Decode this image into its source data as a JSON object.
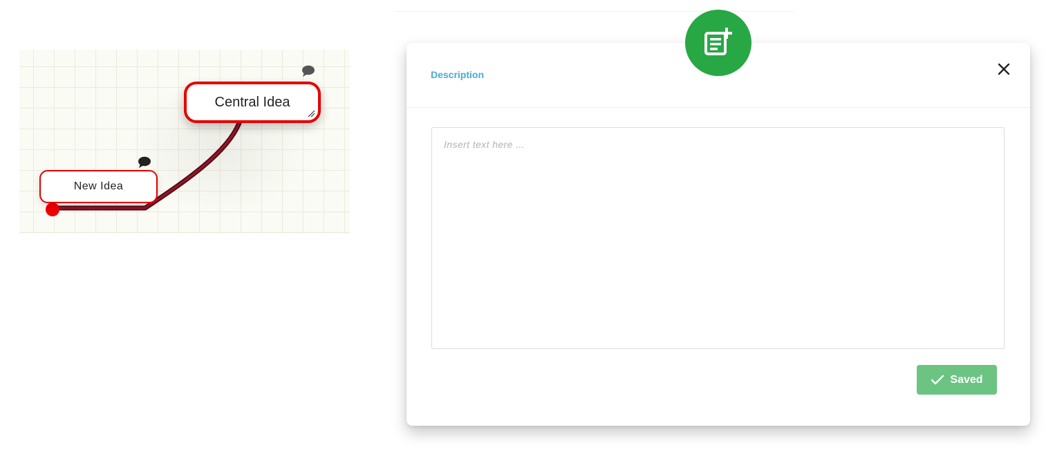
{
  "mindmap": {
    "central_node": {
      "label": "Central Idea",
      "border_color": "#e60000"
    },
    "child_node": {
      "label": "New Idea",
      "border_color": "#e60000"
    },
    "connector_color": "#7a0f22",
    "connector_dot_color": "#ee0000",
    "icons": [
      "comment-icon",
      "resize-grip-icon"
    ]
  },
  "modal": {
    "title": "Description",
    "title_color": "#4aa8d8",
    "badge_icon": "note-add-icon",
    "badge_color": "#28a745",
    "close_icon": "close-icon",
    "textarea": {
      "placeholder": "Insert text here ...",
      "value": ""
    },
    "save_button": {
      "label": "Saved",
      "icon": "check-icon",
      "color": "#6cc483"
    }
  }
}
